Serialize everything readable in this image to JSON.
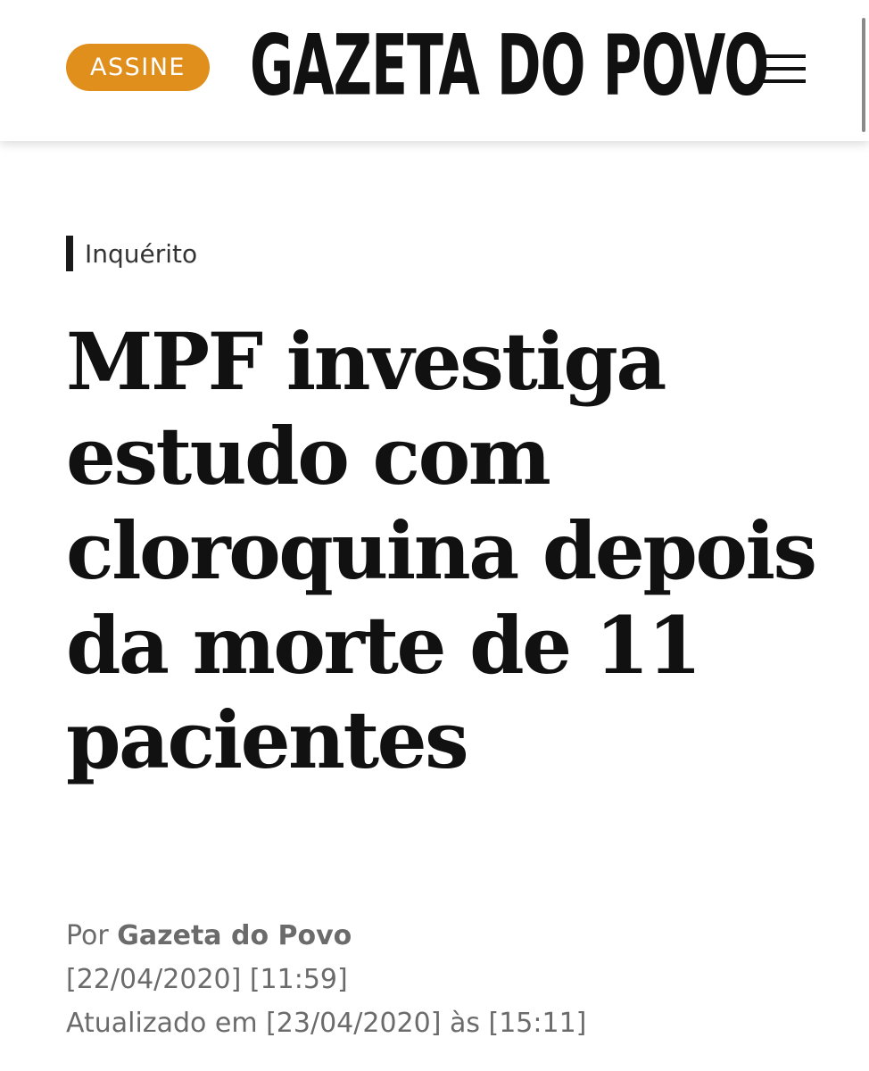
{
  "header": {
    "subscribe_label": "ASSINE",
    "logo_text": "GAZETA DO POVO",
    "menu_icon": "hamburger-menu-icon",
    "accent_color": "#e08e1c"
  },
  "article": {
    "category": "Inquérito",
    "headline": "MPF investiga estudo com cloroquina depois da morte de 11 pacientes",
    "byline_prefix": "Por",
    "author": "Gazeta do Povo",
    "published": "[22/04/2020] [11:59]",
    "updated": "Atualizado em [23/04/2020] às [15:11]"
  }
}
